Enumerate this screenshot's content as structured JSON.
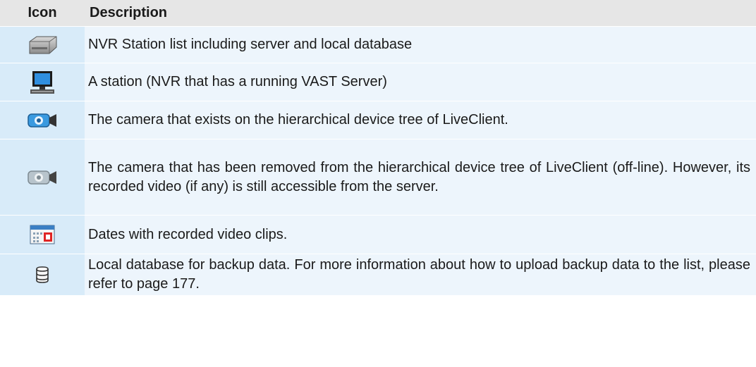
{
  "table": {
    "headers": {
      "icon": "Icon",
      "description": "Description"
    },
    "rows": [
      {
        "icon": "nvr-station-list-icon",
        "description": "NVR Station list including server and local database"
      },
      {
        "icon": "station-monitor-icon",
        "description": "A station (NVR that has a running VAST Server)"
      },
      {
        "icon": "camera-online-icon",
        "description": "The camera that exists on the hierarchical device tree of LiveClient."
      },
      {
        "icon": "camera-offline-icon",
        "description": "The camera that has been removed from the hierarchical device tree of LiveClient (off-line). However, its recorded video (if any) is still accessible from the server."
      },
      {
        "icon": "calendar-dates-icon",
        "description": "Dates with recorded video clips."
      },
      {
        "icon": "database-icon",
        "description": "Local database for backup data. For more information about how to upload backup data to the list, please refer to page 177."
      }
    ]
  },
  "colors": {
    "header_bg": "#e6e6e6",
    "icon_cell_bg": "#d8ebf9",
    "desc_cell_bg": "#edf5fc"
  }
}
